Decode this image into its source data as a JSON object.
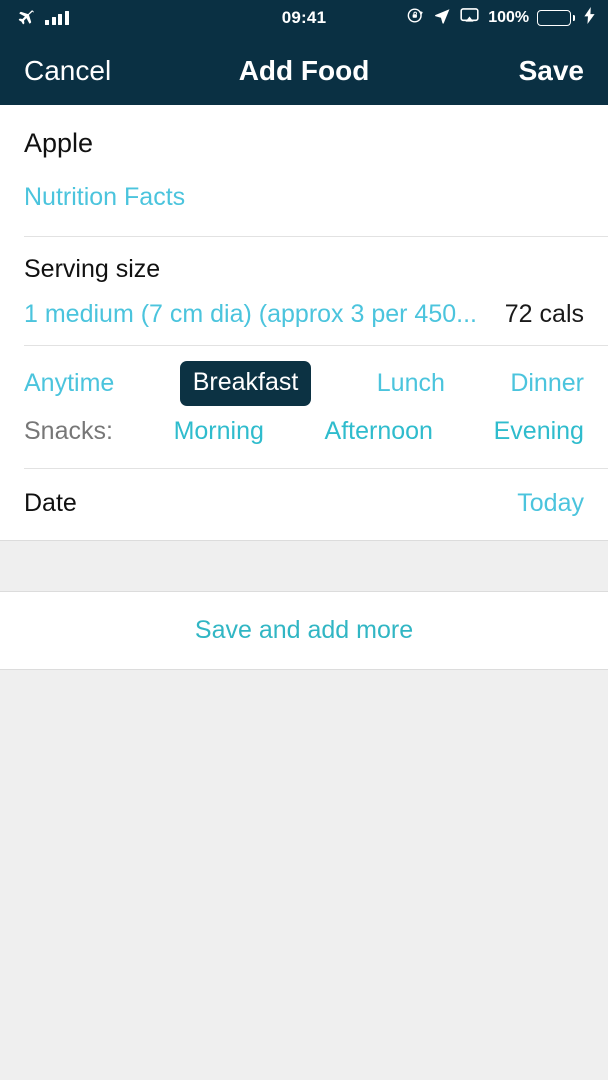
{
  "status_bar": {
    "airplane_icon": "airplane-icon",
    "signal_icon": "signal-bars-icon",
    "time": "09:41",
    "rotation_lock_icon": "rotation-lock-icon",
    "location_icon": "location-arrow-icon",
    "airplay_icon": "airplay-icon",
    "battery_percent": "100%",
    "battery_icon": "battery-icon",
    "charging_icon": "lightning-bolt-icon",
    "bar_bg": "#0a3043",
    "battery_fill": "#4cd749"
  },
  "nav": {
    "cancel_label": "Cancel",
    "title": "Add Food",
    "save_label": "Save"
  },
  "food": {
    "name": "Apple",
    "nutrition_facts_label": "Nutrition Facts"
  },
  "serving": {
    "label": "Serving size",
    "value": "1 medium (7 cm dia) (approx 3 per 450...",
    "calories": "72 cals"
  },
  "meals": {
    "primary": [
      {
        "label": "Anytime",
        "selected": false
      },
      {
        "label": "Breakfast",
        "selected": true
      },
      {
        "label": "Lunch",
        "selected": false
      },
      {
        "label": "Dinner",
        "selected": false
      }
    ],
    "snacks_label": "Snacks:",
    "snacks": [
      {
        "label": "Morning",
        "selected": false
      },
      {
        "label": "Afternoon",
        "selected": false
      },
      {
        "label": "Evening",
        "selected": false
      }
    ],
    "selected_bg": "#0c3243"
  },
  "date": {
    "label": "Date",
    "value": "Today"
  },
  "footer": {
    "save_and_add_more_label": "Save and add more"
  },
  "theme": {
    "link": "#4bc4dd",
    "link_deep": "#31b6c4",
    "header_bg": "#0a3043",
    "page_bg": "#efefef"
  }
}
